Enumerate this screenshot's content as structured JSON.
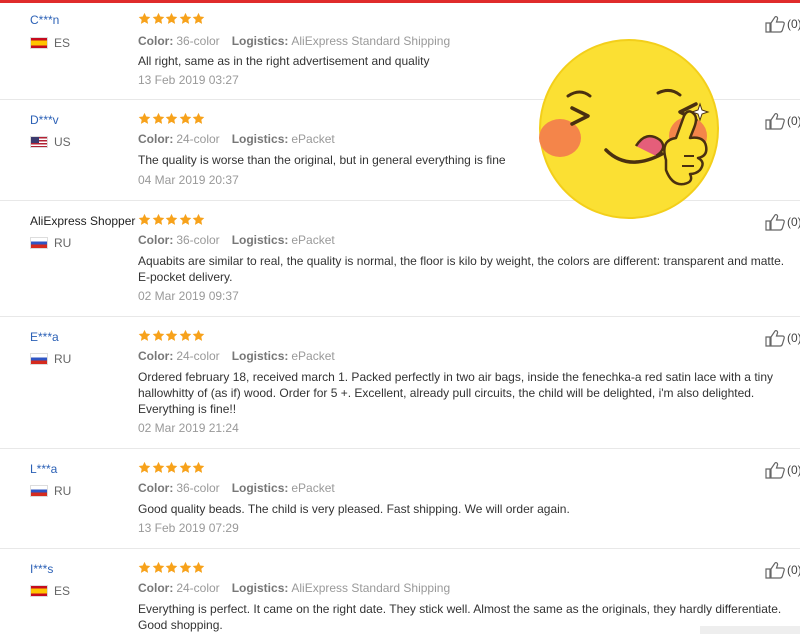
{
  "reviews": [
    {
      "user": "C***n",
      "country": "ES",
      "flag": "es",
      "color_label": "Color:",
      "color_value": "36-color",
      "logistics_label": "Logistics:",
      "logistics_value": "AliExpress Standard Shipping",
      "text": "All right, same as in the right advertisement and quality",
      "date": "13 Feb 2019 03:27",
      "helpful_count": "(0)"
    },
    {
      "user": "D***v",
      "country": "US",
      "flag": "us",
      "color_label": "Color:",
      "color_value": "24-color",
      "logistics_label": "Logistics:",
      "logistics_value": "ePacket",
      "text": "The quality is worse than the original, but in general everything is fine",
      "date": "04 Mar 2019 20:37",
      "helpful_count": "(0)"
    },
    {
      "user": "AliExpress Shopper",
      "country": "RU",
      "flag": "ru",
      "color_label": "Color:",
      "color_value": "36-color",
      "logistics_label": "Logistics:",
      "logistics_value": "ePacket",
      "text": "Aquabits are similar to real, the quality is normal, the floor is kilo by weight, the colors are different: transparent and matte. E-pocket delivery.",
      "date": "02 Mar 2019 09:37",
      "helpful_count": "(0)"
    },
    {
      "user": "E***a",
      "country": "RU",
      "flag": "ru",
      "color_label": "Color:",
      "color_value": "24-color",
      "logistics_label": "Logistics:",
      "logistics_value": "ePacket",
      "text": "Ordered february 18, received march 1. Packed perfectly in two air bags, inside the fenechka-a red satin lace with a tiny hallowhitty of (as if) wood. Order for 5 +. Excellent, already pull circuits, the child will be delighted, i'm also delighted. Everything is fine!!",
      "date": "02 Mar 2019 21:24",
      "helpful_count": "(0)"
    },
    {
      "user": "L***a",
      "country": "RU",
      "flag": "ru",
      "color_label": "Color:",
      "color_value": "36-color",
      "logistics_label": "Logistics:",
      "logistics_value": "ePacket",
      "text": "Good quality beads. The child is very pleased. Fast shipping. We will order again.",
      "date": "13 Feb 2019 07:29",
      "helpful_count": "(0)"
    },
    {
      "user": "I***s",
      "country": "ES",
      "flag": "es",
      "color_label": "Color:",
      "color_value": "24-color",
      "logistics_label": "Logistics:",
      "logistics_value": "AliExpress Standard Shipping",
      "text": "Everything is perfect. It came on the right date. They stick well. Almost the same as the originals, they hardly differentiate. Good shopping.",
      "date": "",
      "helpful_count": "(0)"
    }
  ],
  "colors": {
    "accent": "#e02b2b",
    "username": "#2c61b6",
    "star": "#f7a21b",
    "muted": "#999999"
  },
  "icons": {
    "rating": "star-icon",
    "helpful": "thumbs-up-icon",
    "sticker": "yummy-emoji-sticker"
  }
}
